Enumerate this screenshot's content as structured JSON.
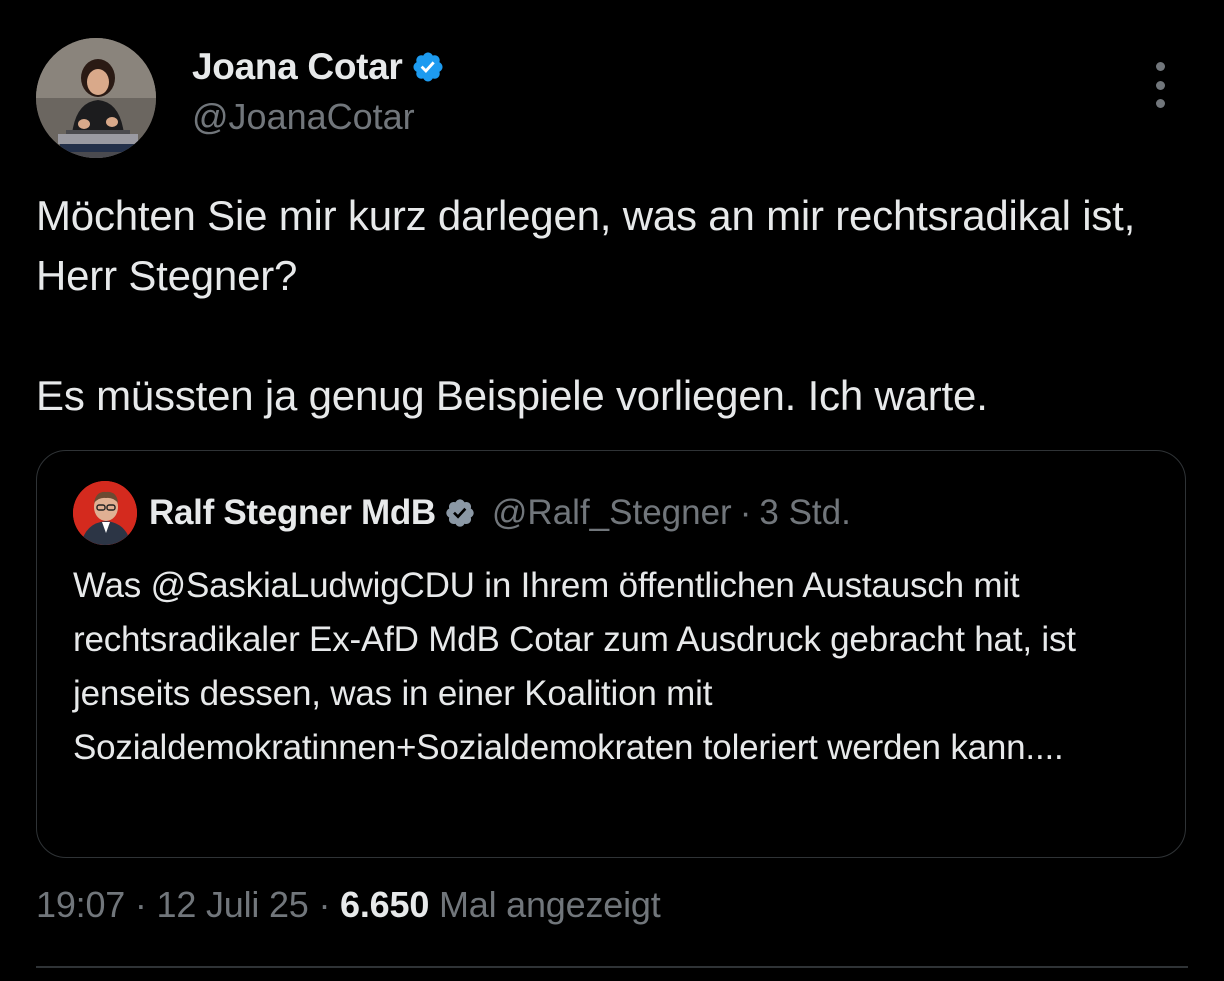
{
  "author": {
    "display_name": "Joana Cotar",
    "handle": "@JoanaCotar",
    "verified": true,
    "verified_badge_icon": "verified-check-icon"
  },
  "tweet": {
    "text": "Möchten Sie mir kurz darlegen, was an mir rechtsradikal ist, Herr Stegner?\n\nEs müssten ja genug Beispiele vorliegen. Ich warte."
  },
  "quoted_tweet": {
    "display_name": "Ralf Stegner MdB",
    "handle": "@Ralf_Stegner",
    "separator": "·",
    "time": "3 Std.",
    "verified": true,
    "text": "Was @SaskiaLudwigCDU in Ihrem öffentlichen Austausch mit rechtsradikaler Ex-AfD MdB Cotar zum Ausdruck gebracht hat, ist jenseits dessen, was in einer Koalition mit Sozialdemokratinnen+Sozialdemokraten toleriert werden kann...."
  },
  "meta": {
    "time": "19:07",
    "sep1": "·",
    "date": "12 Juli 25",
    "sep2": "·",
    "views_count": "6.650",
    "views_label": "Mal angezeigt"
  },
  "colors": {
    "background": "#000000",
    "text_primary": "#e7e9ea",
    "text_secondary": "#71767b",
    "verified_blue": "#1d9bf0",
    "border": "#2f3336"
  }
}
